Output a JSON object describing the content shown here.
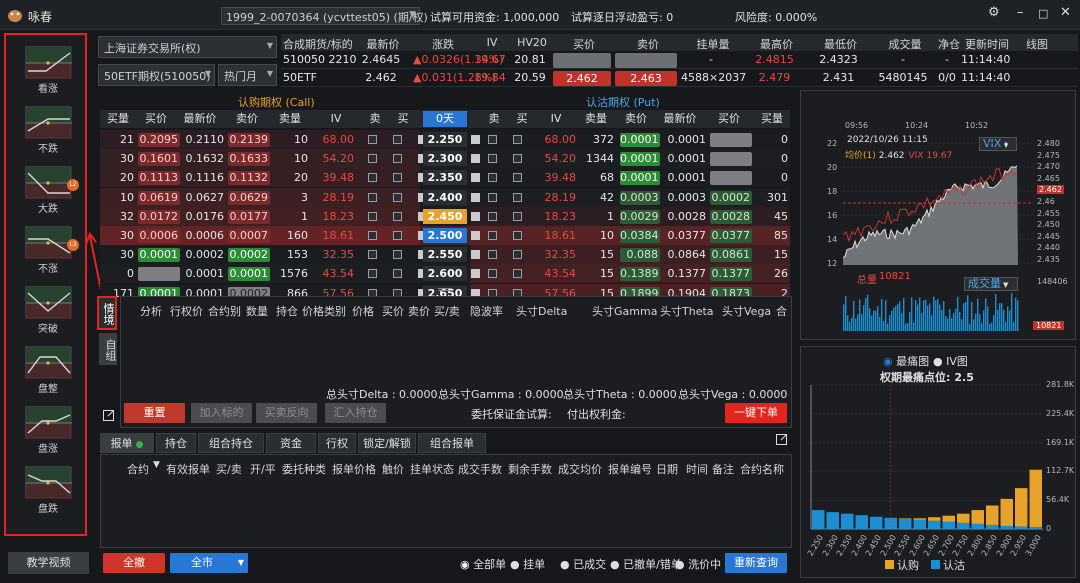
{
  "app": {
    "title": "咏春",
    "account": "1999_2-0070364 (ycvttest05) (期/权)",
    "funds_label": "试算可用资金:",
    "funds": "1,000,000",
    "pnl_label": "试算逐日浮动盈亏:",
    "pnl": "0",
    "risk_label": "风险度:",
    "risk": "0.000%"
  },
  "sidebar": {
    "items": [
      {
        "label": "看涨",
        "badge": ""
      },
      {
        "label": "不跌",
        "badge": ""
      },
      {
        "label": "大跌",
        "badge": "L2"
      },
      {
        "label": "不涨",
        "badge": "L3"
      },
      {
        "label": "突破",
        "badge": ""
      },
      {
        "label": "盘整",
        "badge": ""
      },
      {
        "label": "盘涨",
        "badge": ""
      },
      {
        "label": "盘跌",
        "badge": ""
      }
    ],
    "video_btn": "教学视频"
  },
  "selectors": {
    "exchange": "上海证券交易所(权)",
    "product": "50ETF期权(510050)",
    "month": "热门月"
  },
  "quote": {
    "headers": [
      "合成期货/标的",
      "最新价",
      "涨跌",
      "IV",
      "HV20",
      "买价",
      "卖价",
      "挂单量",
      "最高价",
      "最低价",
      "成交量",
      "净仓",
      "更新时间",
      "线图"
    ],
    "rows": [
      {
        "name": "510050 2210",
        "last": "2.4645",
        "chg": "▲0.0326(1.34%)",
        "iv": "19.67",
        "hv": "20.81",
        "bid": "",
        "ask": "",
        "vol_q": "-",
        "high": "2.4815",
        "low": "2.4323",
        "volume": "-",
        "net": "-",
        "time": "11:14:40"
      },
      {
        "name": "50ETF",
        "last": "2.462",
        "chg": "▲0.031(1.28%)",
        "iv": "19.84",
        "hv": "20.59",
        "bid": "2.462",
        "ask": "2.463",
        "vol_q": "4588×2037",
        "high": "2.479",
        "low": "2.431",
        "volume": "5480145",
        "net": "0/0",
        "time": "11:14:40"
      }
    ]
  },
  "chain": {
    "call_title": "认购期权 (Call)",
    "put_title": "认沽期权 (Put)",
    "days": "0天",
    "headers": [
      "买量",
      "买价",
      "最新价",
      "卖价",
      "卖量",
      "IV",
      "卖",
      "买",
      "",
      "",
      "卖",
      "买",
      "IV",
      "卖量",
      "卖价",
      "最新价",
      "买价",
      "买量"
    ],
    "rows": [
      {
        "cbv": "21",
        "cbp": "0.2095",
        "clast": "0.2110",
        "cap": "0.2139",
        "cav": "10",
        "civ": "68.00",
        "k": "2.250",
        "piv": "68.00",
        "pav": "372",
        "pap": "0.0001",
        "plast": "0.0001",
        "pbp": "",
        "pbv": "0"
      },
      {
        "cbv": "30",
        "cbp": "0.1601",
        "clast": "0.1632",
        "cap": "0.1633",
        "cav": "10",
        "civ": "54.20",
        "k": "2.300",
        "piv": "54.20",
        "pav": "1344",
        "pap": "0.0001",
        "plast": "0.0001",
        "pbp": "",
        "pbv": "0"
      },
      {
        "cbv": "20",
        "cbp": "0.1113",
        "clast": "0.1116",
        "cap": "0.1132",
        "cav": "20",
        "civ": "39.48",
        "k": "2.350",
        "piv": "39.48",
        "pav": "68",
        "pap": "0.0001",
        "plast": "0.0001",
        "pbp": "",
        "pbv": "0"
      },
      {
        "cbv": "10",
        "cbp": "0.0619",
        "clast": "0.0627",
        "cap": "0.0629",
        "cav": "3",
        "civ": "28.19",
        "k": "2.400",
        "piv": "28.19",
        "pav": "42",
        "pap": "0.0003",
        "plast": "0.0003",
        "pbp": "0.0002",
        "pbv": "301"
      },
      {
        "cbv": "32",
        "cbp": "0.0172",
        "clast": "0.0176",
        "cap": "0.0177",
        "cav": "1",
        "civ": "18.23",
        "k": "2.450",
        "piv": "18.23",
        "pav": "1",
        "pap": "0.0029",
        "plast": "0.0028",
        "pbp": "0.0028",
        "pbv": "45"
      },
      {
        "cbv": "30",
        "cbp": "0.0006",
        "clast": "0.0006",
        "cap": "0.0007",
        "cav": "160",
        "civ": "18.61",
        "k": "2.500",
        "piv": "18.61",
        "pav": "10",
        "pap": "0.0384",
        "plast": "0.0377",
        "pbp": "0.0377",
        "pbv": "85"
      },
      {
        "cbv": "30",
        "cbp": "0.0001",
        "clast": "0.0002",
        "cap": "0.0002",
        "cav": "153",
        "civ": "32.35",
        "k": "2.550",
        "piv": "32.35",
        "pav": "15",
        "pap": "0.088",
        "plast": "0.0864",
        "pbp": "0.0861",
        "pbv": "15"
      },
      {
        "cbv": "0",
        "cbp": "",
        "clast": "0.0001",
        "cap": "0.0001",
        "cav": "1576",
        "civ": "43.54",
        "k": "2.600",
        "piv": "43.54",
        "pav": "15",
        "pap": "0.1389",
        "plast": "0.1377",
        "pbp": "0.1377",
        "pbv": "26"
      },
      {
        "cbv": "171",
        "cbp": "0.0001",
        "clast": "0.0001",
        "cap": "0.0002",
        "cav": "866",
        "civ": "57.56",
        "k": "2.650",
        "piv": "57.56",
        "pav": "15",
        "pap": "0.1899",
        "plast": "0.1904",
        "pbp": "0.1873",
        "pbv": "2"
      }
    ]
  },
  "situation": {
    "tab1": "情境",
    "tab2": "自组",
    "headers": [
      "分析",
      "行权价",
      "合约别",
      "数量",
      "持仓",
      "价格类别",
      "价格",
      "买价",
      "卖价",
      "买/卖",
      "隐波率",
      "头寸Delta",
      "头寸Gamma",
      "头寸Theta",
      "头寸Vega",
      "合"
    ],
    "totals": {
      "delta": "总头寸Delta : 0.0000",
      "gamma": "总头寸Gamma : 0.0000",
      "theta": "总头寸Theta : 0.0000",
      "vega": "总头寸Vega : 0.0000"
    },
    "buttons": {
      "reset": "重置",
      "add": "加入标的",
      "reverse": "买卖反向",
      "import": "汇入持仓",
      "oneclick": "一键下单"
    },
    "margin_label": "委托保证金试算:",
    "premium_label": "付出权利金:"
  },
  "orders": {
    "tabs": [
      "报单",
      "持仓",
      "组合持仓",
      "资金",
      "行权",
      "锁定/解锁",
      "组合报单"
    ],
    "headers": [
      "合约",
      "有效报单",
      "买/卖",
      "开/平",
      "委托种类",
      "报单价格",
      "触价",
      "挂单状态",
      "成交手数",
      "剩余手数",
      "成交均价",
      "报单编号",
      "日期",
      "时间",
      "备注",
      "合约名称"
    ],
    "cancel_btn": "全撤",
    "market_btn": "全市",
    "filters": [
      "全部单",
      "挂单",
      "已成交",
      "已撤单/错单",
      "洗价中"
    ],
    "refresh_btn": "重新查询"
  },
  "right": {
    "tabs": [
      "走势分析",
      "盈亏分析",
      "风险分析"
    ],
    "trend": {
      "times": [
        "09:56",
        "10:24",
        "10:52"
      ],
      "date": "2022/10/26 11:15",
      "avg_label": "均价(1)",
      "avg": "2.462",
      "vix_label": "VIX",
      "vix": "19.67",
      "left_ticks": [
        "22",
        "20",
        "18",
        "16",
        "14",
        "12"
      ],
      "right_ticks": [
        "2.480",
        "2.475",
        "2.470",
        "2.465",
        "2.462",
        "2.46",
        "2.455",
        "2.450",
        "2.445",
        "2.440",
        "2.435"
      ],
      "vix_btn": "VIX",
      "vol_label": "总量",
      "vol": "10821",
      "vol_btn": "成交量",
      "vol_tick": "148406",
      "vol_cur": "10821"
    },
    "pain": {
      "radio1": "最痛图",
      "radio2": "IV图",
      "title": "权期最痛点位:",
      "point": "2.5",
      "yticks": [
        "281.8K",
        "225.4K",
        "169.1K",
        "112.7K",
        "56.4K",
        "0"
      ],
      "strikes": [
        "2.250",
        "2.300",
        "2.350",
        "2.400",
        "2.450",
        "2.500",
        "2.550",
        "2.600",
        "2.650",
        "2.700",
        "2.750",
        "2.800",
        "2.850",
        "2.900",
        "2.950",
        "3.000"
      ],
      "legend_call": "认购",
      "legend_put": "认沽",
      "colors": {
        "call": "#e6a229",
        "put": "#1b8fd1"
      }
    }
  },
  "chart_data": {
    "type": "bar",
    "title": "权期最痛点位: 2.5",
    "categories": [
      "2.250",
      "2.300",
      "2.350",
      "2.400",
      "2.450",
      "2.500",
      "2.550",
      "2.600",
      "2.650",
      "2.700",
      "2.750",
      "2.800",
      "2.850",
      "2.900",
      "2.950",
      "3.000"
    ],
    "series": [
      {
        "name": "认沽",
        "values": [
          37,
          33,
          30,
          27,
          24,
          22,
          20,
          18,
          16,
          14,
          12,
          10,
          8,
          6,
          5,
          4
        ]
      },
      {
        "name": "认购",
        "values": [
          0,
          0,
          0,
          0,
          0,
          0,
          1,
          3,
          7,
          12,
          18,
          27,
          38,
          53,
          75,
          112
        ]
      }
    ],
    "ylim": [
      0,
      281.8
    ],
    "ylabel": ""
  }
}
